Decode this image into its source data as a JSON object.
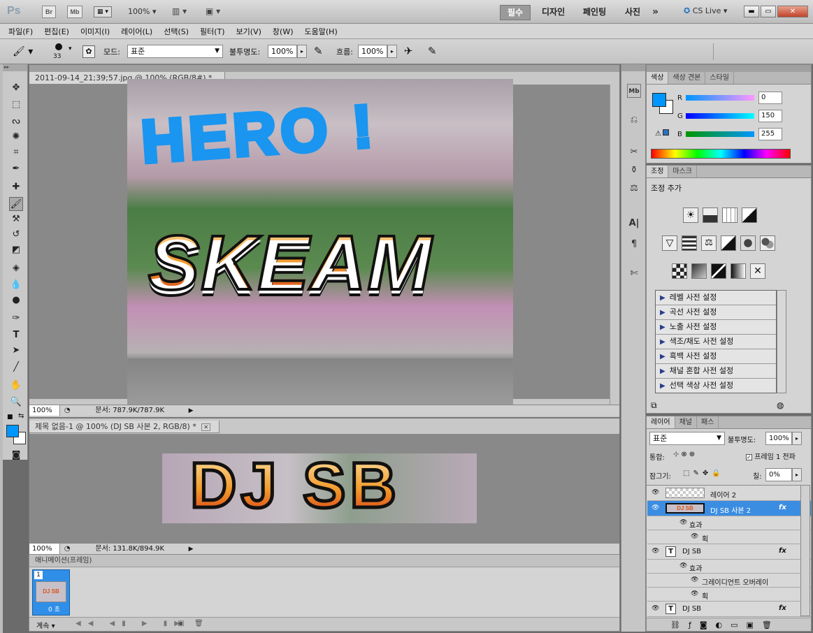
{
  "app": {
    "logo": "Ps",
    "br_label": "Br",
    "mb_label": "Mb",
    "zoom": "100%",
    "workspaces": [
      "필수",
      "디자인",
      "페인팅",
      "사진"
    ],
    "more": "»",
    "cslive": "CS Live"
  },
  "menu": [
    "파일(F)",
    "편집(E)",
    "이미지(I)",
    "레이어(L)",
    "선택(S)",
    "필터(T)",
    "보기(V)",
    "창(W)",
    "도움말(H)"
  ],
  "options": {
    "brush_size": "33",
    "mode_label": "모드:",
    "mode_value": "표준",
    "opacity_label": "불투명도:",
    "opacity_value": "100%",
    "flow_label": "흐름:",
    "flow_value": "100%"
  },
  "doc1": {
    "title": "2011-09-14_21;39;57.jpg @ 100% (RGB/8#) *",
    "zoom": "100%",
    "status": "문서: 787.9K/787.9K",
    "graffiti_top": "HERO !",
    "graffiti_main": "SKEAM"
  },
  "doc2": {
    "title": "제목 없음-1 @ 100% (DJ SB 사본 2, RGB/8) *",
    "zoom": "100%",
    "status": "문서: 131.8K/894.9K",
    "banner_text": "DJ SB"
  },
  "animation": {
    "title": "애니메이션(프레임)",
    "frame_number": "1",
    "frame_time": "0 초",
    "loop": "계속"
  },
  "color_panel": {
    "tabs": [
      "색상",
      "색상 견본",
      "스타일"
    ],
    "r_label": "R",
    "g_label": "G",
    "b_label": "B",
    "r": "0",
    "g": "150",
    "b": "255",
    "fg_color": "#0096ff"
  },
  "adjust_panel": {
    "tabs": [
      "조정",
      "마스크"
    ],
    "title": "조정 추가",
    "presets": [
      "레벨 사전 설정",
      "곡선 사전 설정",
      "노출 사전 설정",
      "색조/채도 사전 설정",
      "흑백 사전 설정",
      "채널 혼합 사전 설정",
      "선택 색상 사전 설정"
    ]
  },
  "layers_panel": {
    "tabs": [
      "레이어",
      "채널",
      "패스"
    ],
    "blend": "표준",
    "opacity_label": "불투명도:",
    "opacity": "100%",
    "unify_label": "통합:",
    "propagate": "프레임 1 전파",
    "lock_label": "잠그기:",
    "fill_label": "칠:",
    "fill": "0%",
    "layers": [
      {
        "name": "레이어 2"
      },
      {
        "name": "DJ SB 사본 2",
        "fx": "fx"
      },
      {
        "name": "효과"
      },
      {
        "name": "획"
      },
      {
        "name": "DJ SB",
        "fx": "fx"
      },
      {
        "name": "효과"
      },
      {
        "name": "그레이디언트 오버레이"
      },
      {
        "name": "획"
      },
      {
        "name": "DJ SB",
        "fx": "fx"
      }
    ]
  }
}
